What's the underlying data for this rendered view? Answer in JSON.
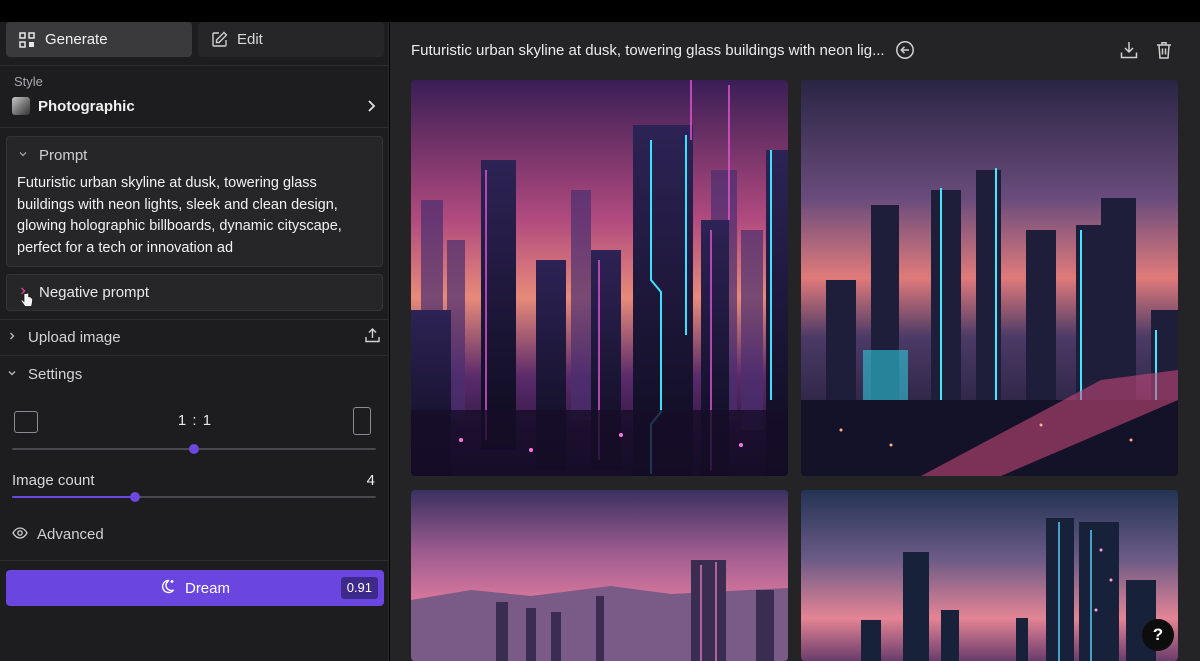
{
  "tabs": {
    "generate": "Generate",
    "edit": "Edit"
  },
  "style": {
    "label": "Style",
    "value": "Photographic"
  },
  "prompt": {
    "heading": "Prompt",
    "text": "Futuristic urban skyline at dusk, towering glass buildings with neon lights, sleek and clean design, glowing holographic billboards, dynamic cityscape, perfect for a tech or innovation ad"
  },
  "negative_prompt": {
    "heading": "Negative prompt"
  },
  "upload": {
    "label": "Upload image"
  },
  "settings": {
    "label": "Settings",
    "aspect_ratio": "1 : 1",
    "aspect_slider_level": 0.5,
    "image_count_label": "Image count",
    "image_count": "4",
    "image_count_slider_level": 0.34
  },
  "advanced": {
    "label": "Advanced"
  },
  "dream": {
    "label": "Dream",
    "cost": "0.91"
  },
  "main": {
    "title": "Futuristic urban skyline at dusk, towering glass buildings with neon lig...",
    "images": [
      "generated-image-1",
      "generated-image-2",
      "generated-image-3",
      "generated-image-4"
    ]
  },
  "help": {
    "label": "?"
  },
  "colors": {
    "accent": "#6b45e0",
    "panel": "#1d1d1f",
    "main_bg": "#242426"
  }
}
